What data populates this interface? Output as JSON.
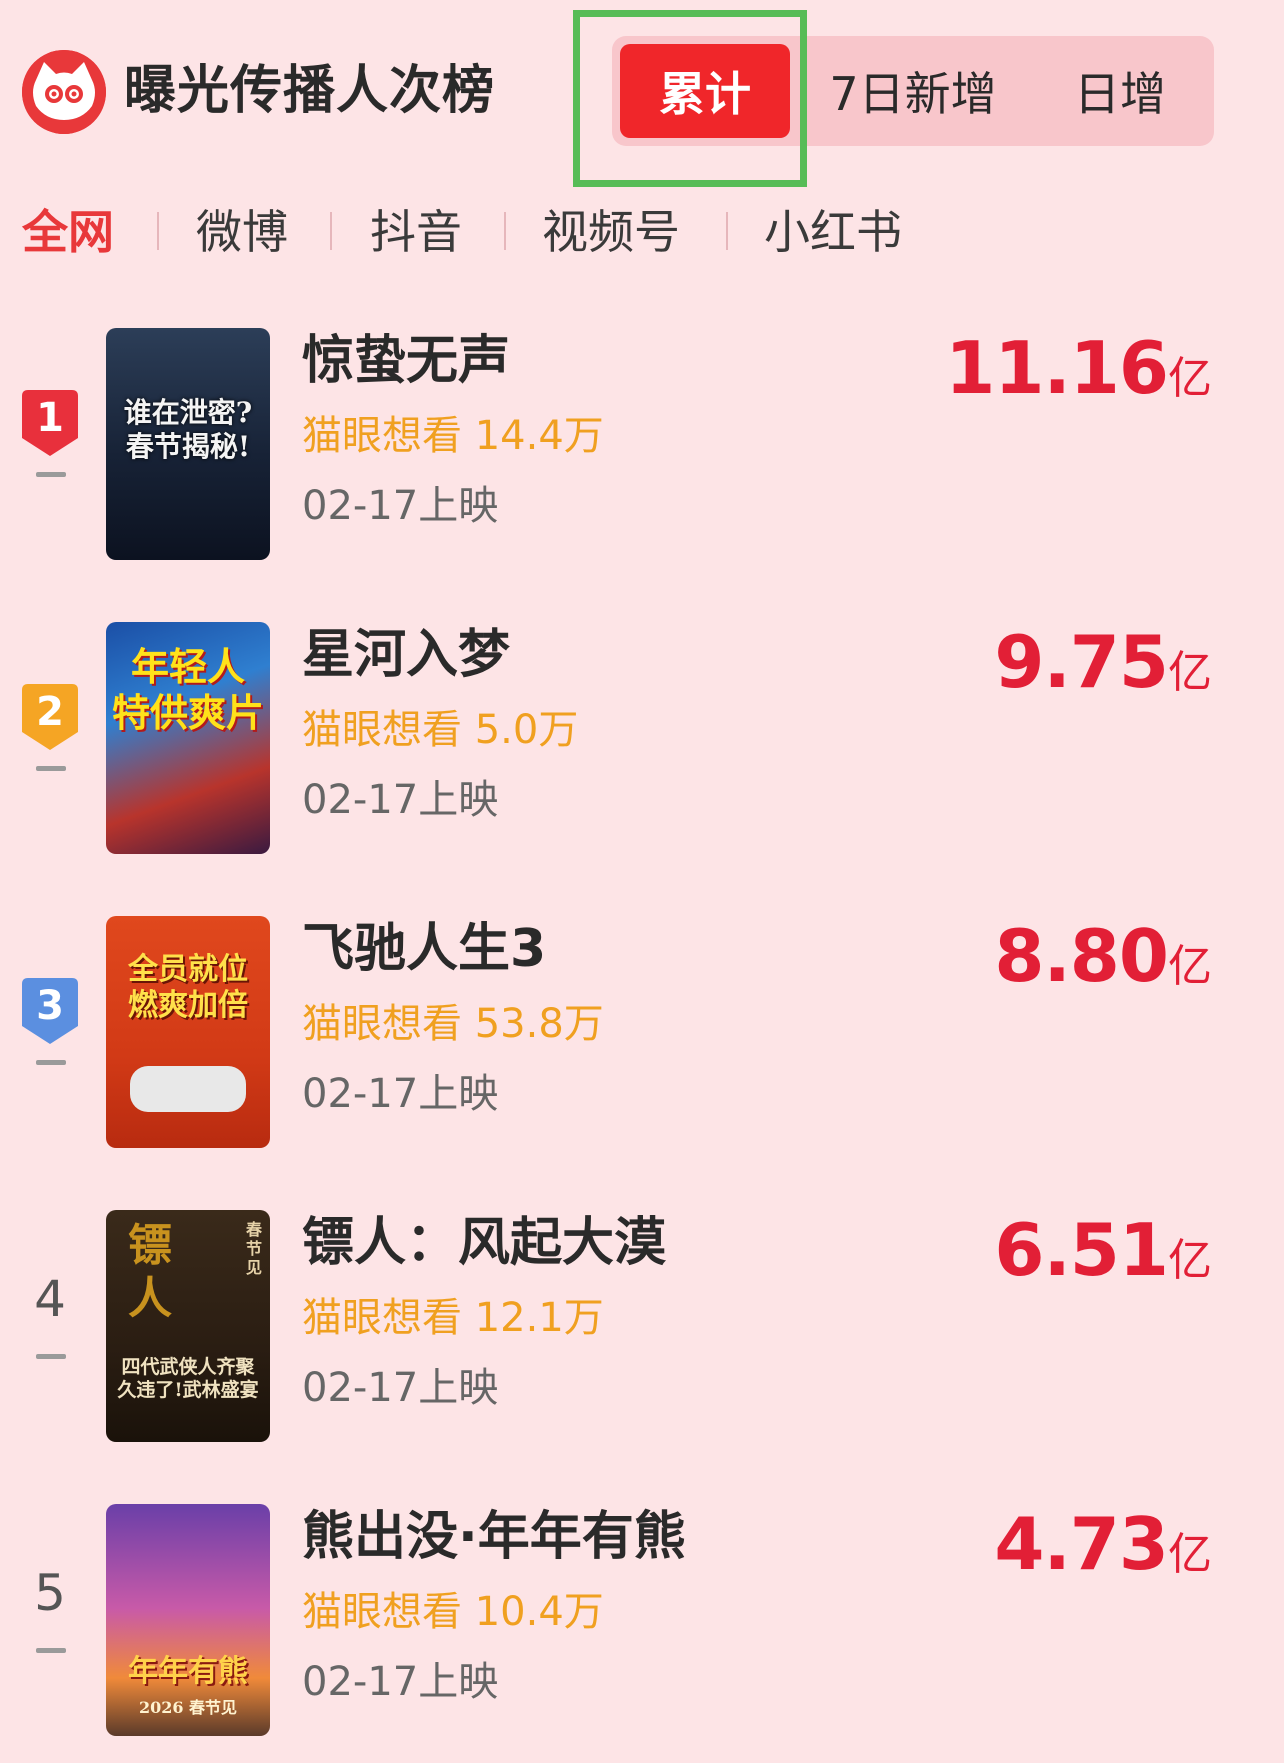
{
  "header": {
    "title": "曝光传播人次榜",
    "segments": {
      "cumulative": "累计",
      "seven_day": "7日新增",
      "daily": "日增"
    }
  },
  "platform_tabs": [
    "全网",
    "微博",
    "抖音",
    "视频号",
    "小红书"
  ],
  "colors": {
    "background": "#fde4e6",
    "accent": "#e8383a",
    "active_segment": "#f0262a",
    "want_text": "#f0a020",
    "value_text": "#e21f36",
    "highlight_box": "#58bc57"
  },
  "movies": [
    {
      "rank": "1",
      "name": "惊蛰无声",
      "want": "猫眼想看 14.4万",
      "release": "02-17上映",
      "value": "11.16",
      "unit": "亿",
      "poster_text": "谁在泄密?\n春节揭秘!"
    },
    {
      "rank": "2",
      "name": "星河入梦",
      "want": "猫眼想看 5.0万",
      "release": "02-17上映",
      "value": "9.75",
      "unit": "亿",
      "poster_text": "年轻人\n特供爽片"
    },
    {
      "rank": "3",
      "name": "飞驰人生3",
      "want": "猫眼想看 53.8万",
      "release": "02-17上映",
      "value": "8.80",
      "unit": "亿",
      "poster_text": "全员就位\n燃爽加倍"
    },
    {
      "rank": "4",
      "name": "镖人：风起大漠",
      "want": "猫眼想看 12.1万",
      "release": "02-17上映",
      "value": "6.51",
      "unit": "亿",
      "poster_text": "四代武侠人齐聚\n久违了!武林盛宴",
      "poster_title": "镖人",
      "poster_corner": "春节见"
    },
    {
      "rank": "5",
      "name": "熊出没·年年有熊",
      "want": "猫眼想看 10.4万",
      "release": "02-17上映",
      "value": "4.73",
      "unit": "亿",
      "poster_text": "年年有熊",
      "poster_sub": "2026 春节见"
    }
  ]
}
